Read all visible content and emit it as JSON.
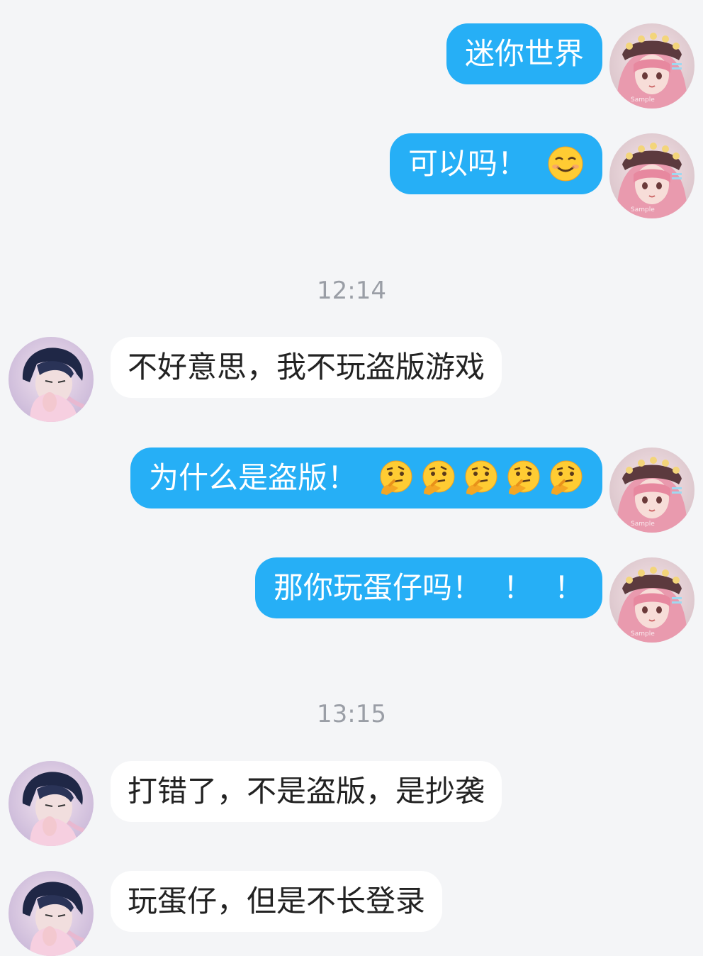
{
  "messages": [
    {
      "side": "out",
      "text": "迷你世界",
      "emojis": []
    },
    {
      "side": "out",
      "text": "可以吗！",
      "emojis": [
        "smiling-face-icon"
      ]
    },
    {
      "time": "12:14"
    },
    {
      "side": "in",
      "text": "不好意思，我不玩盗版游戏"
    },
    {
      "side": "out",
      "text": "为什么是盗版！",
      "emojis": [
        "thinking-face-icon",
        "thinking-face-icon",
        "thinking-face-icon",
        "thinking-face-icon",
        "thinking-face-icon"
      ]
    },
    {
      "side": "out",
      "text": "那你玩蛋仔吗！",
      "extra": [
        "！",
        "！"
      ]
    },
    {
      "time": "13:15"
    },
    {
      "side": "in",
      "text": "打错了，不是盗版，是抄袭"
    },
    {
      "side": "in",
      "text": "玩蛋仔，但是不长登录"
    }
  ],
  "avatar_watermark": "Sample",
  "colors": {
    "outgoing_bubble": "#26aff6",
    "incoming_bubble": "#ffffff",
    "background": "#f4f5f7",
    "timestamp": "#9a9ea6"
  }
}
